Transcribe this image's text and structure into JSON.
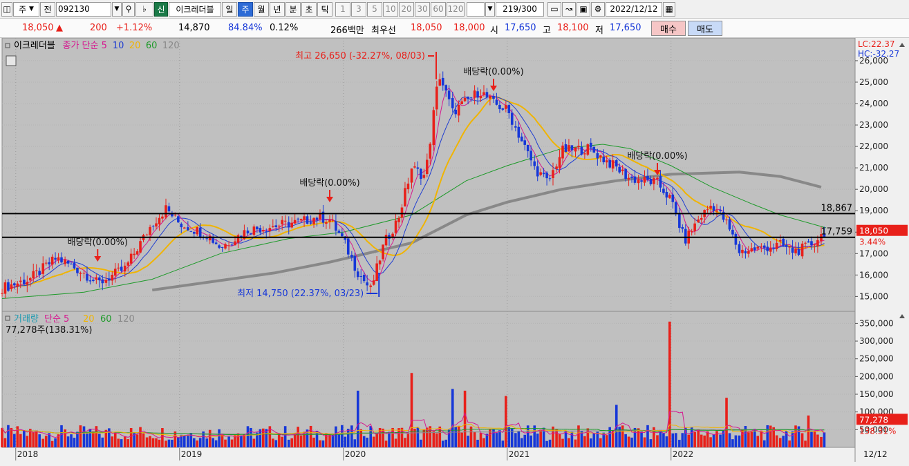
{
  "toolbar": {
    "market_label": "주",
    "prev_label": "전",
    "code": "092130",
    "credit_badge": "신",
    "stock_name": "이크레더블",
    "period_tabs": [
      "일",
      "주",
      "월",
      "년",
      "분",
      "초",
      "틱"
    ],
    "active_period": "주",
    "interval_buttons": [
      "1",
      "3",
      "5",
      "10",
      "20",
      "30",
      "60",
      "120"
    ],
    "count_value": "219",
    "count_total": "/300",
    "date_value": "2022/12/12"
  },
  "quote": {
    "price": "18,050",
    "change": "200",
    "change_pct": "+1.12%",
    "volume": "14,870",
    "ratio": "84.84%",
    "turnover": "0.12%",
    "amount": "266백만",
    "best_label": "최우선",
    "ask": "18,050",
    "bid": "18,000",
    "open_label": "시",
    "open": "17,650",
    "high_label": "고",
    "high": "18,100",
    "low_label": "저",
    "low": "17,650",
    "buy_label": "매수",
    "sell_label": "매도",
    "colors": {
      "up": "#e8201a",
      "down": "#1637d8",
      "buy_bg": "#f6c6c6",
      "sell_bg": "#c8daf7"
    }
  },
  "chart_data": [
    {
      "type": "candlestick",
      "panel": "price",
      "legend": [
        {
          "text": "이크레더블",
          "color": "#000000"
        },
        {
          "text": "종가 단순 5",
          "color": "#d6178f"
        },
        {
          "text": "10",
          "color": "#1f3dd1"
        },
        {
          "text": "20",
          "color": "#f0b400"
        },
        {
          "text": "60",
          "color": "#1e9a2a"
        },
        {
          "text": "120",
          "color": "#888888"
        }
      ],
      "top_right": [
        {
          "text": "LC:22.37",
          "color": "#e8201a"
        },
        {
          "text": "HC:-32.27",
          "color": "#1637d8"
        }
      ],
      "y_ticks": [
        15000,
        16000,
        17000,
        18000,
        19000,
        20000,
        21000,
        22000,
        23000,
        24000,
        25000,
        26000
      ],
      "y_tick_labels": [
        "15,000",
        "16,000",
        "17,000",
        "18,000",
        "19,000",
        "20,000",
        "21,000",
        "22,000",
        "23,000",
        "24,000",
        "25,000",
        "26,000"
      ],
      "ylim": [
        14400,
        26900
      ],
      "x_labels": [
        {
          "text": "2018",
          "x": "2018-01"
        },
        {
          "text": "2019",
          "x": "2019-01"
        },
        {
          "text": "2020",
          "x": "2020-01"
        },
        {
          "text": "2021",
          "x": "2021-01"
        },
        {
          "text": "2022",
          "x": "2022-01"
        },
        {
          "text": "12/12",
          "x": "2022-12-12"
        }
      ],
      "xlim": [
        "2017-12",
        "2022-12-12"
      ],
      "price_path": [
        [
          "2017-12",
          15400
        ],
        [
          "2018-02",
          15800
        ],
        [
          "2018-04",
          16800
        ],
        [
          "2018-06",
          16100
        ],
        [
          "2018-07",
          15600
        ],
        [
          "2018-09",
          16300
        ],
        [
          "2018-11",
          18400
        ],
        [
          "2018-12",
          19100
        ],
        [
          "2019-01",
          18400
        ],
        [
          "2019-03",
          17900
        ],
        [
          "2019-04",
          17300
        ],
        [
          "2019-06",
          18100
        ],
        [
          "2019-08",
          18300
        ],
        [
          "2019-10",
          18500
        ],
        [
          "2019-11",
          18700
        ],
        [
          "2019-12",
          18600
        ],
        [
          "2020-01",
          17600
        ],
        [
          "2020-02",
          16200
        ],
        [
          "2020-03",
          15300
        ],
        [
          "2020-04",
          17500
        ],
        [
          "2020-05",
          18600
        ],
        [
          "2020-06",
          21000
        ],
        [
          "2020-07",
          20600
        ],
        [
          "2020-08",
          25400
        ],
        [
          "2020-09",
          23600
        ],
        [
          "2020-11",
          24600
        ],
        [
          "2020-12",
          24000
        ],
        [
          "2021-01",
          23700
        ],
        [
          "2021-03",
          21000
        ],
        [
          "2021-04",
          20300
        ],
        [
          "2021-05",
          21800
        ],
        [
          "2021-07",
          21900
        ],
        [
          "2021-09",
          21000
        ],
        [
          "2021-10",
          20500
        ],
        [
          "2021-12",
          20300
        ],
        [
          "2022-01",
          19500
        ],
        [
          "2022-02",
          17600
        ],
        [
          "2022-03",
          18600
        ],
        [
          "2022-04",
          19300
        ],
        [
          "2022-05",
          18500
        ],
        [
          "2022-06",
          17100
        ],
        [
          "2022-07",
          17200
        ],
        [
          "2022-09",
          17400
        ],
        [
          "2022-10",
          17100
        ],
        [
          "2022-11",
          17300
        ],
        [
          "2022-12-12",
          18050
        ]
      ],
      "ma60_path": [
        [
          "2017-12",
          14900
        ],
        [
          "2018-06",
          15200
        ],
        [
          "2018-11",
          15800
        ],
        [
          "2019-04",
          17000
        ],
        [
          "2019-09",
          17700
        ],
        [
          "2020-01",
          18000
        ],
        [
          "2020-06",
          18800
        ],
        [
          "2020-10",
          20400
        ],
        [
          "2021-01",
          21100
        ],
        [
          "2021-05",
          21900
        ],
        [
          "2021-08",
          22100
        ],
        [
          "2021-10",
          21900
        ],
        [
          "2022-01",
          21100
        ],
        [
          "2022-04",
          20100
        ],
        [
          "2022-07",
          19300
        ],
        [
          "2022-09",
          18800
        ],
        [
          "2022-12-12",
          18200
        ]
      ],
      "ma120_path": [
        [
          "2018-11",
          15300
        ],
        [
          "2019-08",
          16100
        ],
        [
          "2019-12",
          16600
        ],
        [
          "2020-06",
          17500
        ],
        [
          "2020-10",
          18800
        ],
        [
          "2021-01",
          19400
        ],
        [
          "2021-05",
          20000
        ],
        [
          "2021-09",
          20400
        ],
        [
          "2022-01",
          20700
        ],
        [
          "2022-06",
          20800
        ],
        [
          "2022-09",
          20600
        ],
        [
          "2022-12",
          20100
        ]
      ],
      "hlines": [
        {
          "value": 18867,
          "label": "18,867"
        },
        {
          "value": 17759,
          "label": "17,759"
        }
      ],
      "current_price": {
        "value": 18050,
        "label": "18,050",
        "change_label": "3.44%"
      },
      "annotations": {
        "high": {
          "text": "최고 26,650 (-32.27%, 08/03)",
          "x": "2020-08"
        },
        "low": {
          "text": "최저 14,750 (22.37%, 03/23)",
          "x": "2020-03"
        },
        "dividends": [
          {
            "text": "배당락(0.00%)",
            "x": "2018-07"
          },
          {
            "text": "배당락(0.00%)",
            "x": "2019-12"
          },
          {
            "text": "배당락(0.00%)",
            "x": "2020-12"
          },
          {
            "text": "배당락(0.00%)",
            "x": "2021-12"
          }
        ]
      }
    },
    {
      "type": "bar",
      "panel": "volume",
      "legend": [
        {
          "text": "거래량",
          "color": "#1c9ab0"
        },
        {
          "text": "단순 5",
          "color": "#d6178f"
        },
        {
          "text": "20",
          "color": "#f0b400"
        },
        {
          "text": "60",
          "color": "#1e9a2a"
        },
        {
          "text": "120",
          "color": "#888888"
        }
      ],
      "info": "77,278주(138.31%)",
      "y_ticks": [
        50000,
        100000,
        150000,
        200000,
        250000,
        300000,
        350000
      ],
      "y_tick_labels": [
        "50,000",
        "100,000",
        "150,000",
        "200,000",
        "250,000",
        "300,000",
        "350,000"
      ],
      "ylim": [
        0,
        380000
      ],
      "current": {
        "label": "77,278",
        "pct_label": "138.31%"
      },
      "spikes": [
        {
          "x": "2020-02",
          "value": 160000
        },
        {
          "x": "2020-06",
          "value": 210000
        },
        {
          "x": "2020-09",
          "value": 165000
        },
        {
          "x": "2020-10",
          "value": 160000
        },
        {
          "x": "2021-01",
          "value": 160000
        },
        {
          "x": "2021-01",
          "value": 145000
        },
        {
          "x": "2021-09",
          "value": 120000
        },
        {
          "x": "2022-01",
          "value": 355000
        },
        {
          "x": "2022-05",
          "value": 140000
        },
        {
          "x": "2022-11",
          "value": 90000
        }
      ]
    }
  ]
}
